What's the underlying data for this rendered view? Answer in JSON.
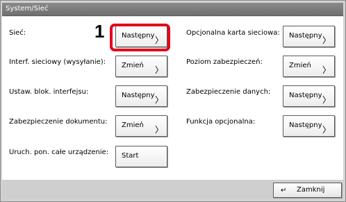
{
  "window": {
    "title": "System/Sieć"
  },
  "settings": [
    {
      "label": "Sieć:",
      "button": "Następny"
    },
    {
      "label": "Opcjonalna karta sieciowa:",
      "button": "Następny"
    },
    {
      "label": "Interf. sieciowy (wysyłanie):",
      "button": "Zmień"
    },
    {
      "label": "Poziom zabezpieczeń:",
      "button": "Zmień"
    },
    {
      "label": "Ustaw. blok. interfejsu:",
      "button": "Następny"
    },
    {
      "label": "Zabezpieczenie danych:",
      "button": "Następny"
    },
    {
      "label": "Zabezpieczenie dokumentu:",
      "button": "Zmień"
    },
    {
      "label": "Funkcja opcjonalna:",
      "button": "Następny"
    },
    {
      "label": "Uruch. pon. całe urządzenie:",
      "button": "Start"
    }
  ],
  "callout": {
    "step_number": "1"
  },
  "footer": {
    "close_label": "Zamknij",
    "return_icon": "↵"
  },
  "icons": {
    "chevron": "〉"
  },
  "colors": {
    "highlight": "#e3001b",
    "titlebar": "#7a7a7a"
  }
}
